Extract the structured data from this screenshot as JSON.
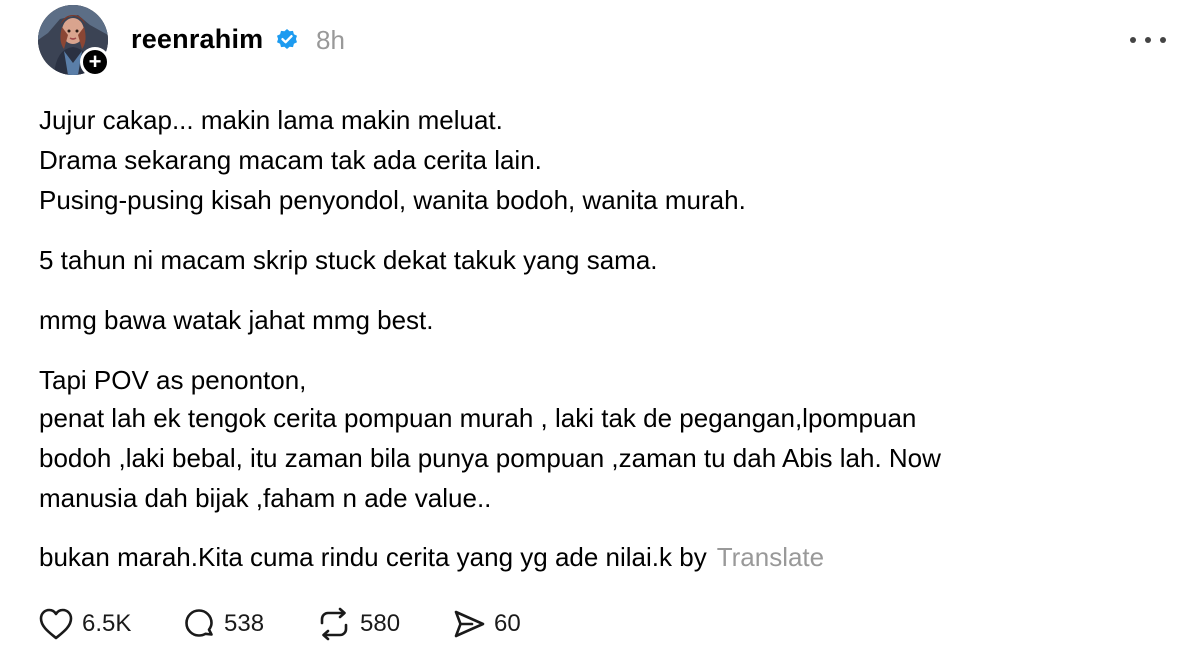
{
  "post": {
    "username": "reenrahim",
    "timestamp": "8h",
    "lines": [
      "Jujur cakap... makin lama makin meluat.",
      "Drama sekarang macam tak ada cerita lain.",
      "Pusing-pusing kisah penyondol, wanita bodoh, wanita murah.",
      "5 tahun ni macam skrip stuck dekat takuk yang sama.",
      "mmg bawa watak jahat mmg best.",
      "Tapi POV as penonton,",
      "penat lah ek tengok cerita pompuan murah , laki tak de pegangan,lpompuan",
      "bodoh ,laki bebal, itu zaman bila punya pompuan ,zaman tu dah Abis lah. Now",
      "manusia dah bijak ,faham n ade value..",
      "bukan marah.Kita cuma rindu cerita yang yg ade nilai.k by"
    ],
    "translate_label": "Translate"
  },
  "actions": {
    "likes": "6.5K",
    "replies": "538",
    "reposts": "580",
    "shares": "60"
  },
  "icons": {
    "verified": "verified-badge-icon",
    "more": "more-options-icon",
    "like": "heart-icon",
    "reply": "comment-bubble-icon",
    "repost": "repost-icon",
    "share": "send-icon"
  },
  "colors": {
    "verified": "#1d9bf0",
    "muted": "#999999"
  }
}
